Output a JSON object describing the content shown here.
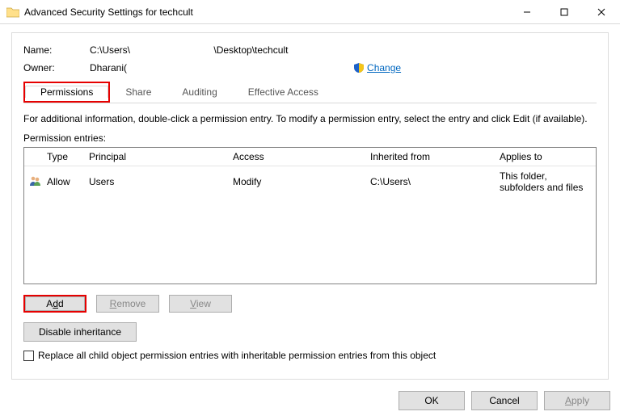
{
  "titlebar": {
    "title": "Advanced Security Settings for techcult"
  },
  "info": {
    "name_label": "Name:",
    "name_value": "C:\\Users\\                               \\Desktop\\techcult",
    "owner_label": "Owner:",
    "owner_value": "Dharani(",
    "change_label": "Change"
  },
  "tabs": {
    "permissions": "Permissions",
    "share": "Share",
    "auditing": "Auditing",
    "effective": "Effective Access"
  },
  "hint": "For additional information, double-click a permission entry. To modify a permission entry, select the entry and click Edit (if available).",
  "entries_label": "Permission entries:",
  "grid": {
    "headers": {
      "type": "Type",
      "principal": "Principal",
      "access": "Access",
      "inherited": "Inherited from",
      "applies": "Applies to"
    },
    "row": {
      "type": "Allow",
      "principal": "Users",
      "access": "Modify",
      "inherited": "C:\\Users\\\u0001",
      "applies": "This folder, subfolders and files"
    }
  },
  "buttons": {
    "add": "Add",
    "remove": "Remove",
    "view": "View",
    "disable_inheritance_pre": "Disable ",
    "disable_inheritance_ul": "i",
    "disable_inheritance_post": "nheritance"
  },
  "checkbox": {
    "label": "Replace all child object permission entries with inheritable permission entries from this object"
  },
  "footer": {
    "ok": "OK",
    "cancel": "Cancel",
    "apply": "Apply"
  }
}
